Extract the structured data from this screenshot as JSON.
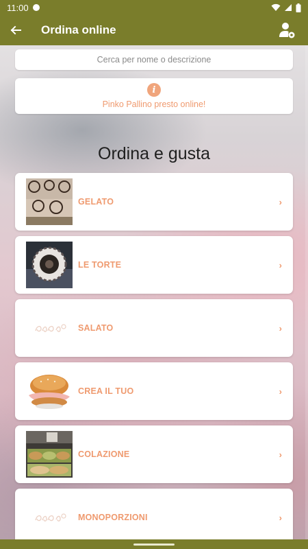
{
  "status": {
    "time": "11:00"
  },
  "appbar": {
    "title": "Ordina online"
  },
  "search": {
    "placeholder": "Cerca per nome o descrizione"
  },
  "notice": {
    "message": "Pinko Pallino presto online!"
  },
  "section_title": "Ordina e gusta",
  "categories": [
    {
      "label": "GELATO",
      "thumb": "gelato-photo"
    },
    {
      "label": "LE TORTE",
      "thumb": "torte-photo"
    },
    {
      "label": "SALATO",
      "thumb": "logo-watermark"
    },
    {
      "label": "CREA IL TUO",
      "thumb": "sandwich-photo"
    },
    {
      "label": "COLAZIONE",
      "thumb": "colazione-photo"
    },
    {
      "label": "MONOPORZIONI",
      "thumb": "logo-watermark"
    }
  ],
  "chevron": "›",
  "colors": {
    "bar": "#7a7d2b",
    "accent": "#ef9a6f"
  }
}
